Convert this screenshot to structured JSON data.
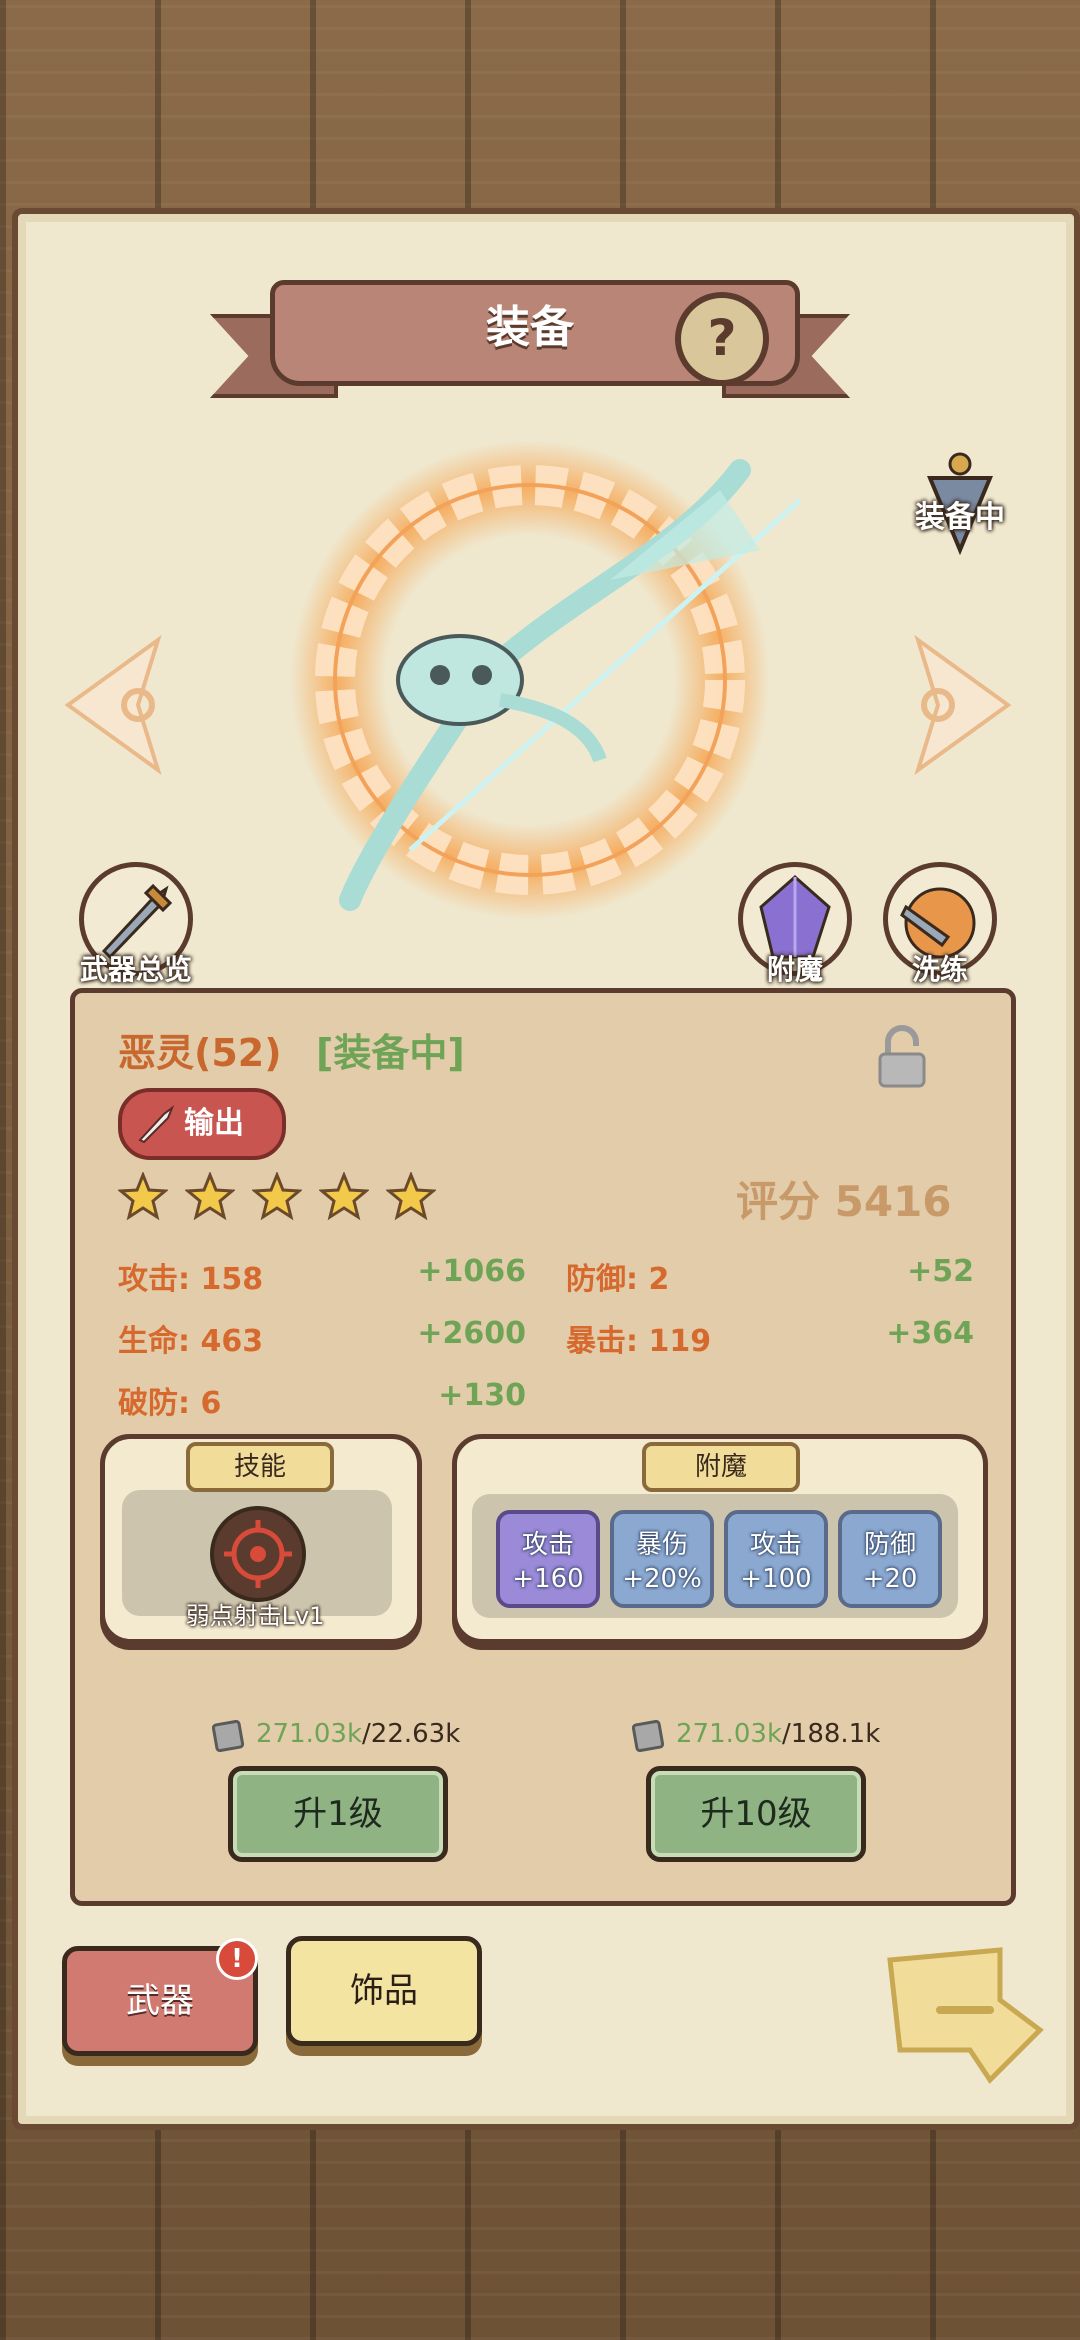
{
  "header": {
    "title": "装备",
    "help_icon": "question-mark-icon"
  },
  "weapon": {
    "equipped_flag": "装备中",
    "name": "恶灵(52)",
    "status": "[装备中]",
    "role": "输出",
    "stars": 5,
    "score": "评分 5416"
  },
  "side_buttons": {
    "overview": "武器总览",
    "enchant": "附魔",
    "reforge": "洗练"
  },
  "stats": [
    {
      "key": "攻击: 158",
      "bonus": "+1066"
    },
    {
      "key": "防御: 2",
      "bonus": "+52"
    },
    {
      "key": "生命: 463",
      "bonus": "+2600"
    },
    {
      "key": "暴击: 119",
      "bonus": "+364"
    },
    {
      "key": "破防: 6",
      "bonus": "+130"
    }
  ],
  "skill": {
    "tag": "技能",
    "name": "弱点射击Lv1"
  },
  "enchant": {
    "tag": "附魔",
    "slots": [
      {
        "label": "攻击",
        "value": "+160"
      },
      {
        "label": "暴伤",
        "value": "+20%"
      },
      {
        "label": "攻击",
        "value": "+100"
      },
      {
        "label": "防御",
        "value": "+20"
      }
    ]
  },
  "upgrade": [
    {
      "have": "271.03k",
      "need": "/22.63k",
      "button": "升1级"
    },
    {
      "have": "271.03k",
      "need": "/188.1k",
      "button": "升10级"
    }
  ],
  "tabs": {
    "weapon": "武器",
    "accessory": "饰品",
    "badge": "!"
  },
  "colors": {
    "accent": "#c8682e",
    "green": "#6fa457",
    "ink": "#5a3b2e"
  }
}
